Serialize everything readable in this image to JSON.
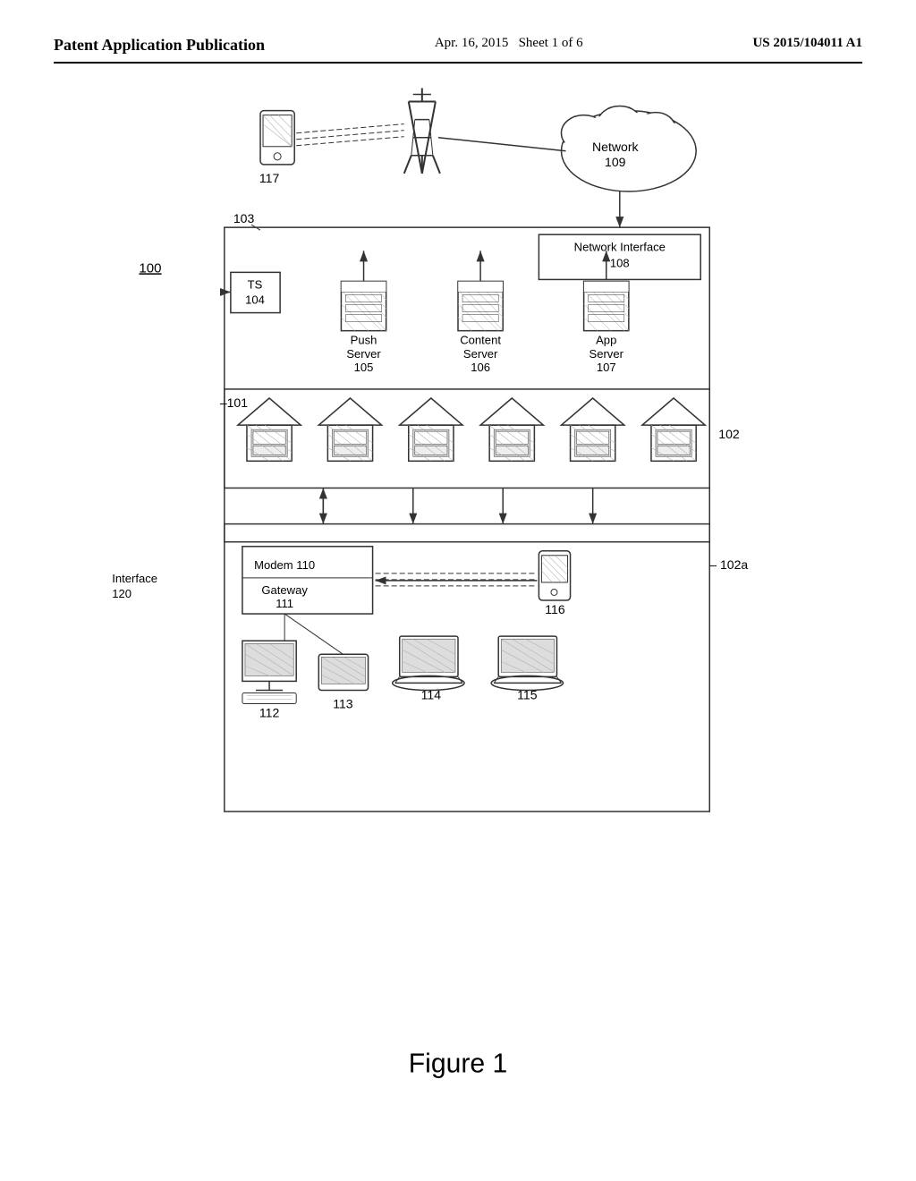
{
  "header": {
    "left": "Patent Application Publication",
    "center_date": "Apr. 16, 2015",
    "center_sheet": "Sheet 1 of 6",
    "right": "US 2015/104011 A1"
  },
  "labels": {
    "figure": "Figure 1",
    "network": "Network\n109",
    "network_interface": "Network Interface\n108",
    "ts": "TS\n104",
    "push_server": "Push\nServer\n105",
    "content_server": "Content\nServer\n106",
    "app_server": "App\nServer\n107",
    "ref_100": "100",
    "ref_101": "101",
    "ref_102": "102",
    "ref_102a": "102a",
    "ref_103": "103",
    "modem": "Modem 110",
    "gateway": "Gateway\n111",
    "ref_112": "112",
    "ref_113": "113",
    "ref_114": "114",
    "ref_115": "115",
    "ref_116": "116",
    "ref_117": "117",
    "interface": "Interface\n120"
  }
}
